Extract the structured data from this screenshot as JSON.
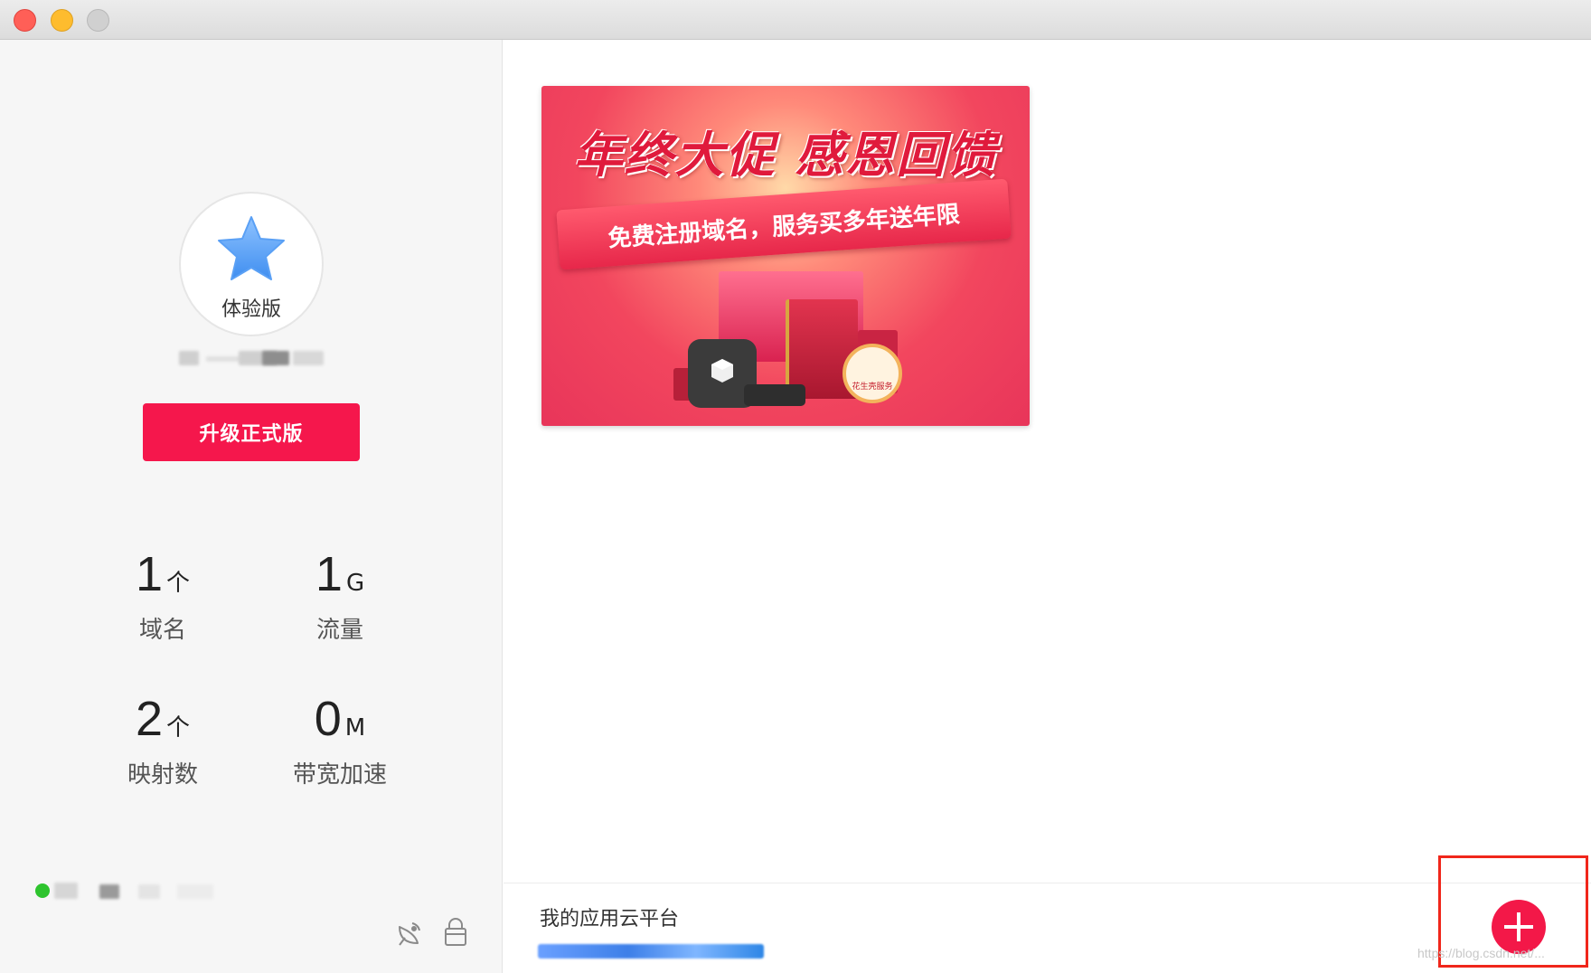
{
  "sidebar": {
    "edition_label": "体验版",
    "upgrade_button": "升级正式版",
    "stats": [
      {
        "value": "1",
        "unit": "个",
        "label": "域名"
      },
      {
        "value": "1",
        "unit": "G",
        "label": "流量"
      },
      {
        "value": "2",
        "unit": "个",
        "label": "映射数"
      },
      {
        "value": "0",
        "unit": "M",
        "label": "带宽加速"
      }
    ],
    "status_icons": [
      "signal-icon",
      "lock-icon"
    ]
  },
  "banner": {
    "title": "年终大促  感恩回馈",
    "ribbon": "免费注册域名，服务买多年送年限",
    "badge_text": "花生壳服务"
  },
  "main": {
    "cloud_platform_label": "我的应用云平台"
  },
  "colors": {
    "accent": "#f5174c",
    "highlight_box": "#f0261b",
    "status_online": "#2ec42e"
  },
  "watermark": "https://blog.csdn.net/..."
}
